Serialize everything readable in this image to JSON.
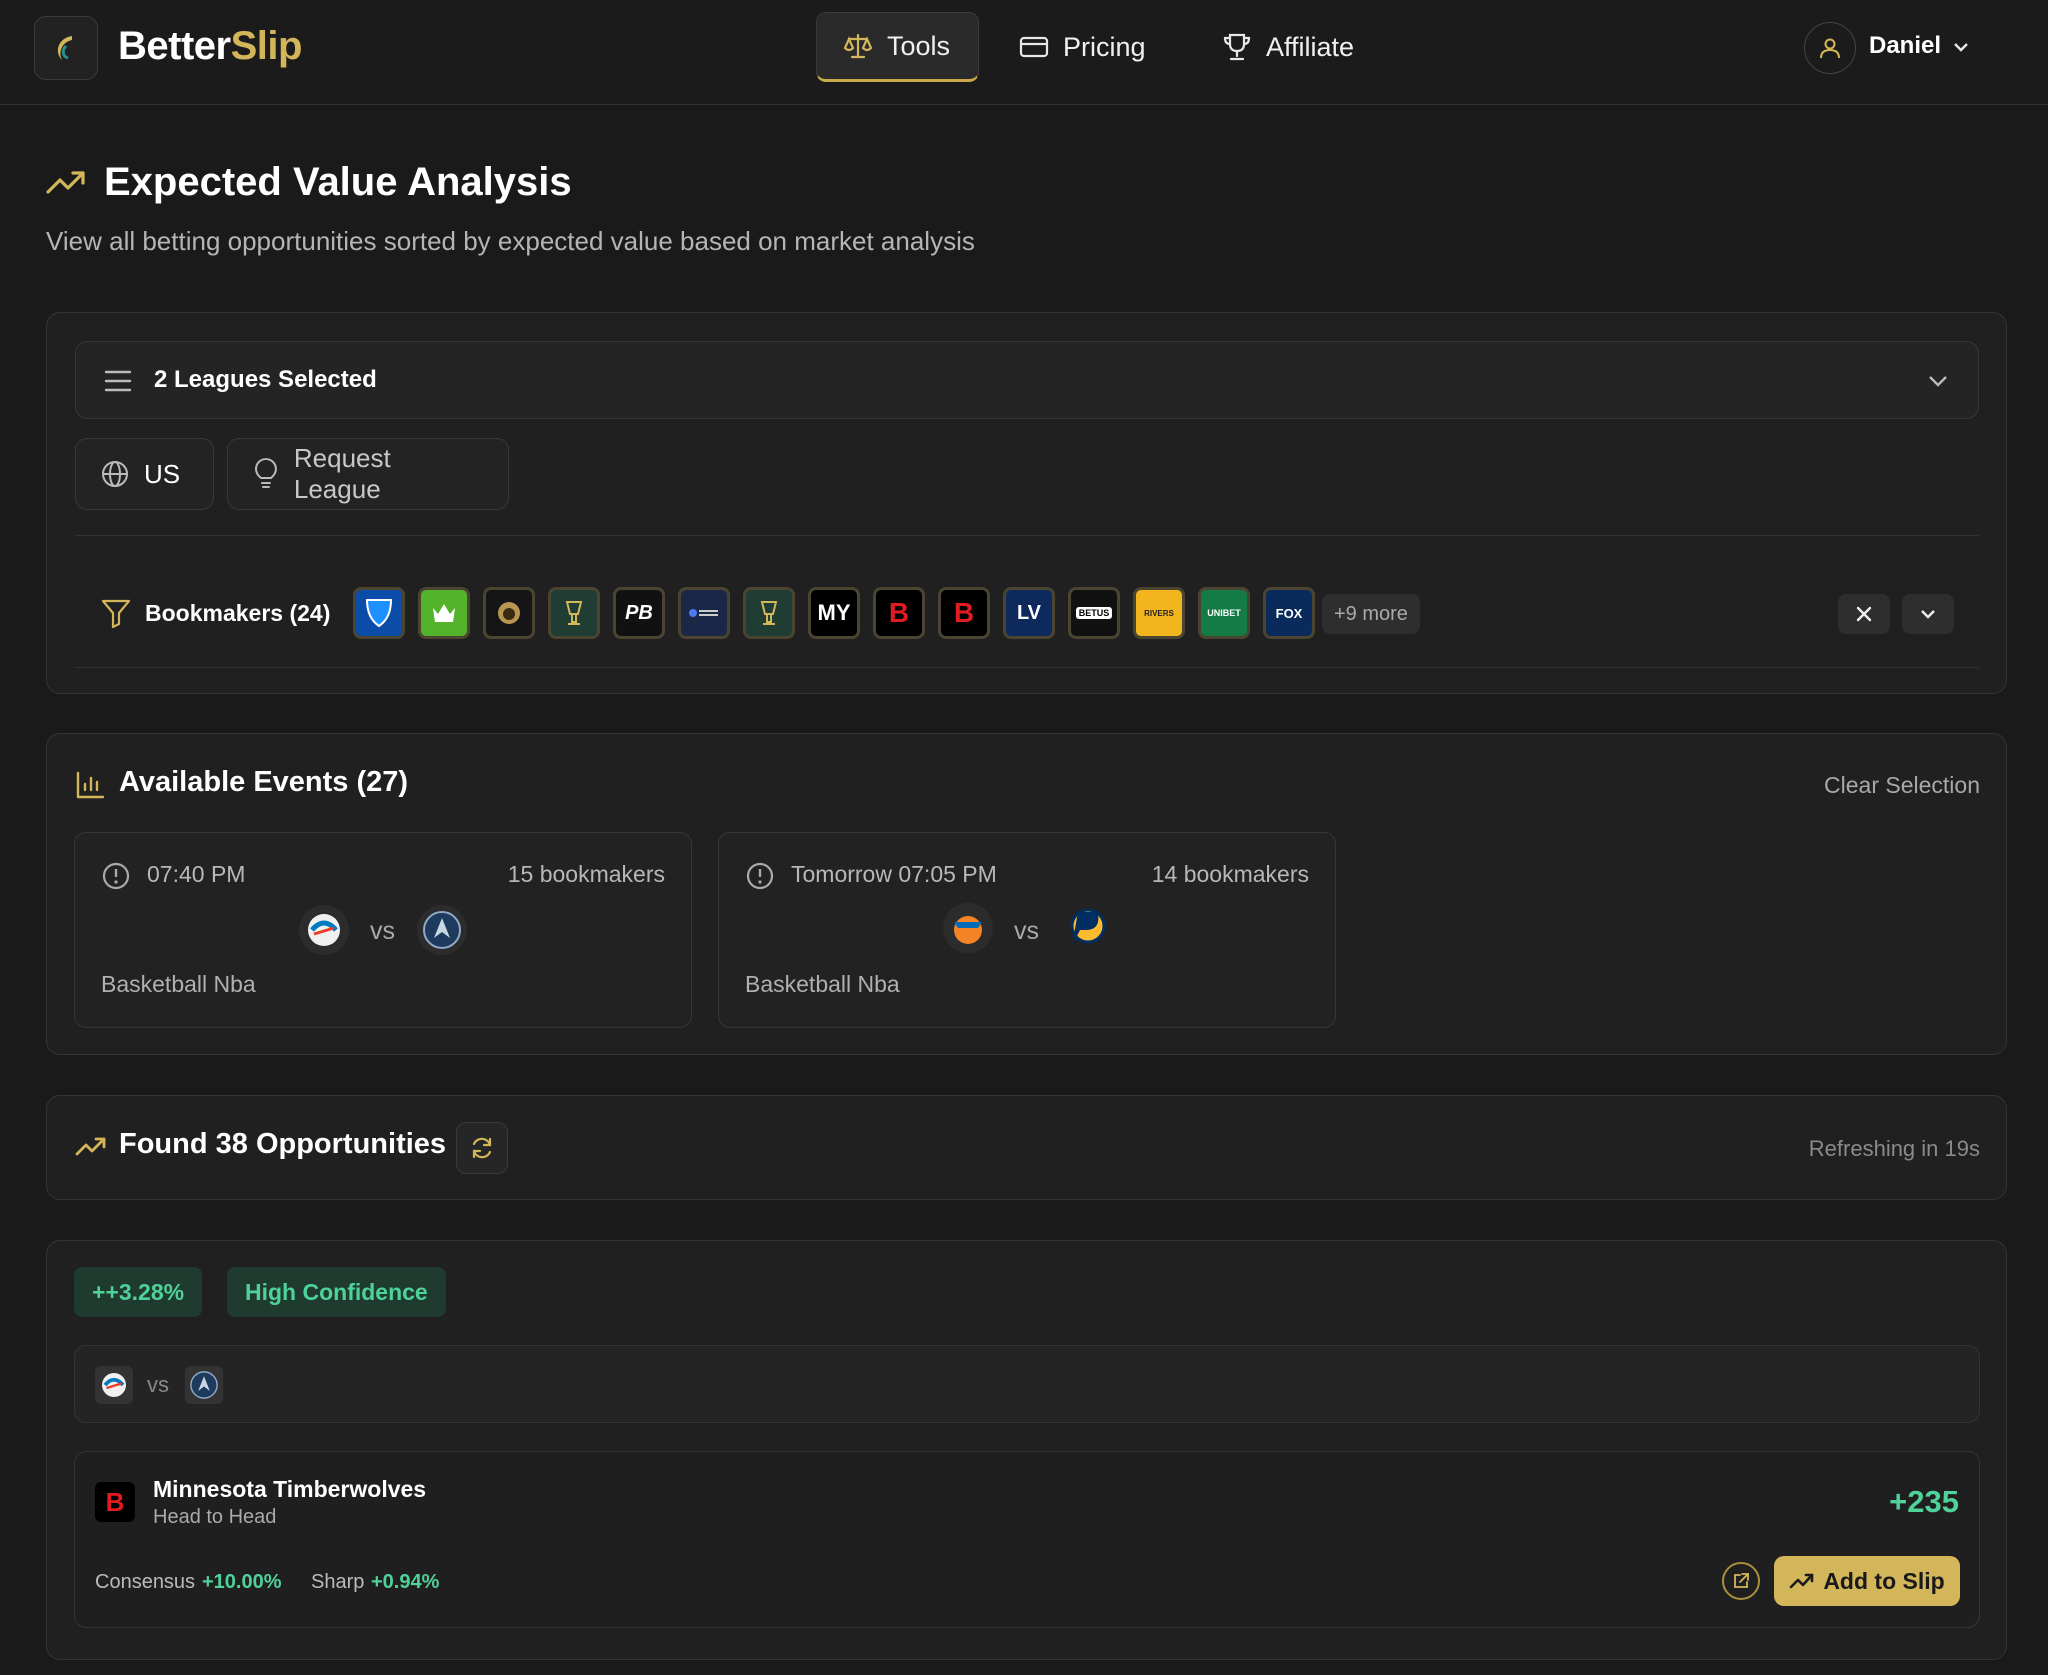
{
  "app": {
    "brand_a": "Better",
    "brand_b": "Slip"
  },
  "nav": {
    "tools": "Tools",
    "pricing": "Pricing",
    "affiliate": "Affiliate"
  },
  "user": {
    "name": "Daniel"
  },
  "page": {
    "title": "Expected Value Analysis",
    "subtitle": "View all betting opportunities sorted by expected value based on market analysis"
  },
  "filters": {
    "leagues_label": "2 Leagues Selected",
    "region": "US",
    "request_league": "Request League",
    "bookmakers_label": "Bookmakers (24)",
    "bookmakers": [
      {
        "name": "fanduel",
        "text": "",
        "bg": "#0b4ca8",
        "fg": "#fff"
      },
      {
        "name": "draftkings",
        "text": "",
        "bg": "#53b32a",
        "fg": "#fff"
      },
      {
        "name": "betmgm",
        "text": "",
        "bg": "#1a1a1a",
        "fg": "#c8a656"
      },
      {
        "name": "caesars-1",
        "text": "",
        "bg": "#1f3d33",
        "fg": "#d4b65a"
      },
      {
        "name": "pointsbet",
        "text": "PB",
        "bg": "#111",
        "fg": "#fff"
      },
      {
        "name": "betrivers",
        "text": "",
        "bg": "#1a2747",
        "fg": "#fff"
      },
      {
        "name": "caesars-2",
        "text": "",
        "bg": "#1f3d33",
        "fg": "#d4b65a"
      },
      {
        "name": "mybookie",
        "text": "MY",
        "bg": "#000",
        "fg": "#fff"
      },
      {
        "name": "bovada",
        "text": "B",
        "bg": "#000",
        "fg": "#e01b22"
      },
      {
        "name": "betonline",
        "text": "B",
        "bg": "#000",
        "fg": "#e01b22"
      },
      {
        "name": "lowvig",
        "text": "LV",
        "bg": "#0e2a5c",
        "fg": "#fff"
      },
      {
        "name": "betus",
        "text": "BETUS",
        "bg": "#111",
        "fg": "#fff"
      },
      {
        "name": "betrivers-yellow",
        "text": "RIVERS",
        "bg": "#f2b51e",
        "fg": "#222"
      },
      {
        "name": "unibet",
        "text": "UNIBET",
        "bg": "#147b45",
        "fg": "#fff"
      },
      {
        "name": "foxbet",
        "text": "FOX",
        "bg": "#0b2a5c",
        "fg": "#fff"
      }
    ],
    "more": "+9 more"
  },
  "events": {
    "title": "Available Events (27)",
    "clear": "Clear Selection",
    "items": [
      {
        "time": "07:40 PM",
        "bookmakers": "15 bookmakers",
        "vs": "vs",
        "league": "Basketball Nba",
        "home": "OKC",
        "away": "MIN"
      },
      {
        "time": "Tomorrow 07:05 PM",
        "bookmakers": "14 bookmakers",
        "vs": "vs",
        "league": "Basketball Nba",
        "home": "NYK",
        "away": "IND"
      }
    ]
  },
  "opportunities": {
    "title": "Found 38 Opportunities",
    "refreshing": "Refreshing in 19s",
    "items": [
      {
        "ev": "++3.28%",
        "confidence": "High Confidence",
        "vs": "vs",
        "selection": "Minnesota Timberwolves",
        "market": "Head to Head",
        "odds": "+235",
        "consensus_label": "Consensus",
        "consensus_value": "+10.00%",
        "sharp_label": "Sharp",
        "sharp_value": "+0.94%",
        "add_label": "Add to Slip"
      }
    ]
  },
  "colors": {
    "accent": "#d4b65a",
    "positive": "#4fd19a",
    "bg": "#1a1a1a"
  }
}
